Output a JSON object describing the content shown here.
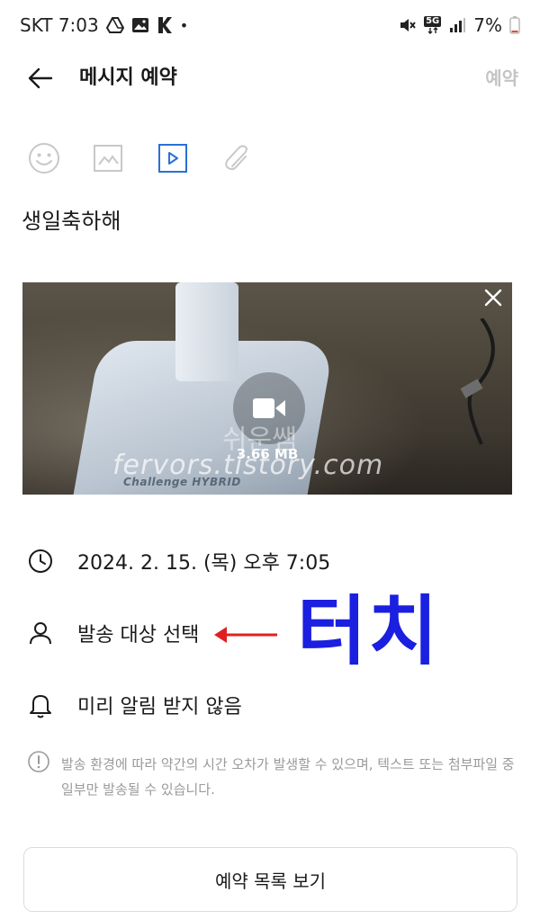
{
  "status_bar": {
    "carrier_time": "SKT 7:03",
    "dot": "•",
    "network": "5G",
    "battery": "7%",
    "icons": [
      "drive-icon",
      "gallery-icon",
      "k-app-icon",
      "mute-icon",
      "5g-icon",
      "signal-icon",
      "battery-icon"
    ]
  },
  "header": {
    "title": "메시지 예약",
    "action_label": "예약"
  },
  "toolbar": {
    "icons": [
      "emoji-icon",
      "image-icon",
      "video-icon",
      "attachment-icon"
    ],
    "active_color": "#2b6fd6",
    "inactive_color": "#c8c8c8"
  },
  "message": {
    "text": "생일축하해"
  },
  "video": {
    "file_size": "3.66 MB",
    "watermark_sub": "쉬운쌤",
    "watermark": "fervors.tistory.com",
    "brand_text": "Challenge HYBRID"
  },
  "options": {
    "datetime": "2024. 2. 15. (목) 오후 7:05",
    "recipient": "발송 대상 선택",
    "alarm": "미리 알림 받지 않음"
  },
  "annotation": {
    "text": "터치",
    "color": "#1a1fe0",
    "arrow_color": "#e02020"
  },
  "notice": {
    "text": "발송 환경에 따라 약간의 시간 오차가 발생할 수 있으며, 텍스트 또는 첨부파일 중 일부만 발송될 수 있습니다."
  },
  "footer": {
    "list_button": "예약 목록 보기"
  }
}
